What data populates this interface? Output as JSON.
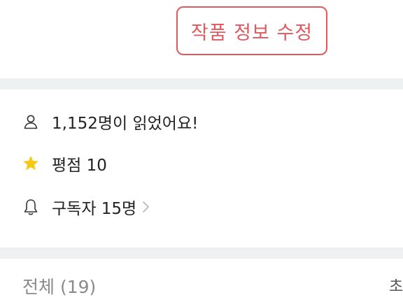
{
  "header": {
    "edit_button_label": "작품 정보 수정"
  },
  "info": {
    "readers_text": "1,152명이 읽었어요!",
    "rating_text": "평점 10",
    "subscribers_text": "구독자 15명"
  },
  "list": {
    "title": "전체 (19)",
    "sort_label_partial": "초"
  },
  "colors": {
    "accent": "#e0595e",
    "star": "#f6c915",
    "divider": "#eef1f1",
    "muted_text": "#8a8a8a"
  },
  "icons": {
    "readers": "person-icon",
    "rating": "star-icon",
    "subscribers": "bell-icon",
    "more": "chevron-right-icon"
  }
}
